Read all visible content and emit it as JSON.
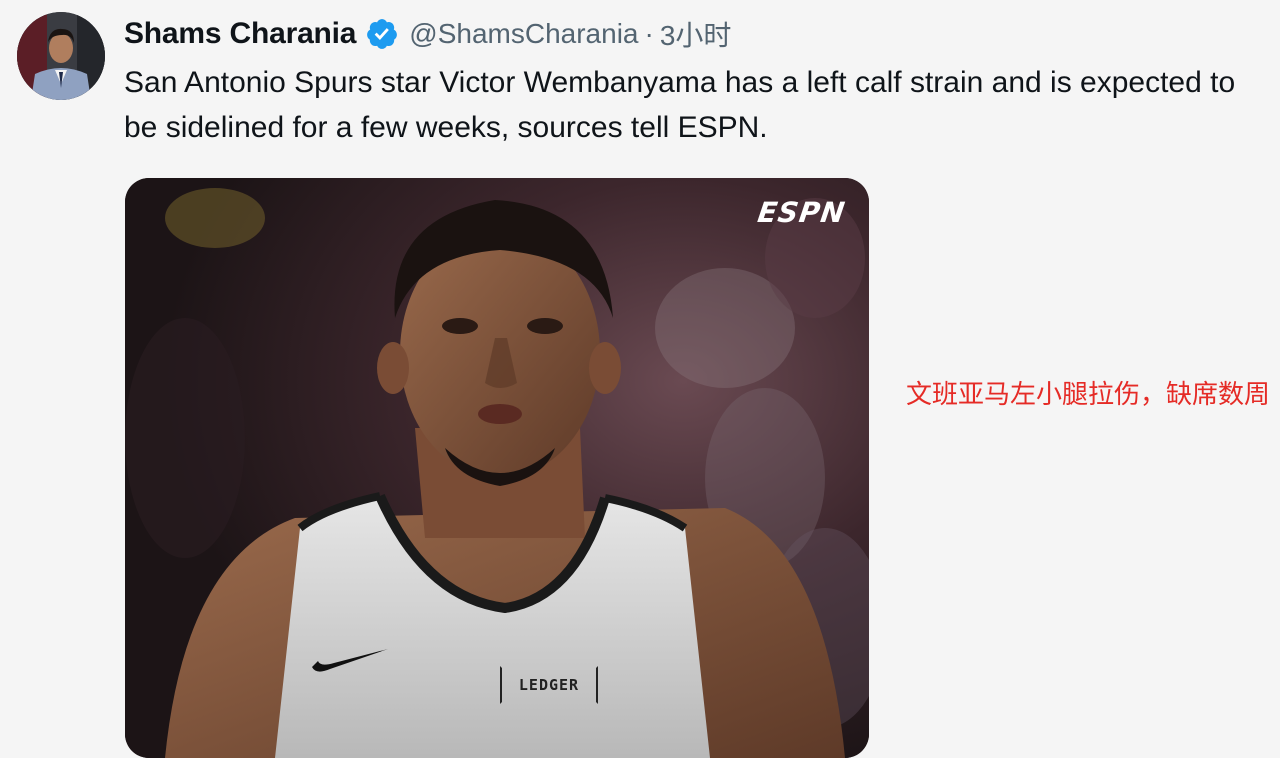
{
  "tweet": {
    "author_name": "Shams Charania",
    "handle": "@ShamsCharania",
    "separator": "·",
    "time": "3小时",
    "text": "San Antonio Spurs star Victor Wembanyama has a left calf strain and is expected to be sidelined for a few weeks, sources tell ESPN.",
    "verified": true
  },
  "media": {
    "watermark": "ESPN",
    "jersey_patch": "LEDGER"
  },
  "annotation": {
    "text": "文班亚马左小腿拉伤，缺席数周"
  },
  "colors": {
    "background": "#f5f5f5",
    "verified_badge": "#1d9bf0",
    "text_primary": "#0f1419",
    "text_secondary": "#536471",
    "annotation": "#e52b26"
  },
  "icons": {
    "verified": "verified-badge-icon",
    "nike_logo": "nike-swoosh-icon"
  }
}
